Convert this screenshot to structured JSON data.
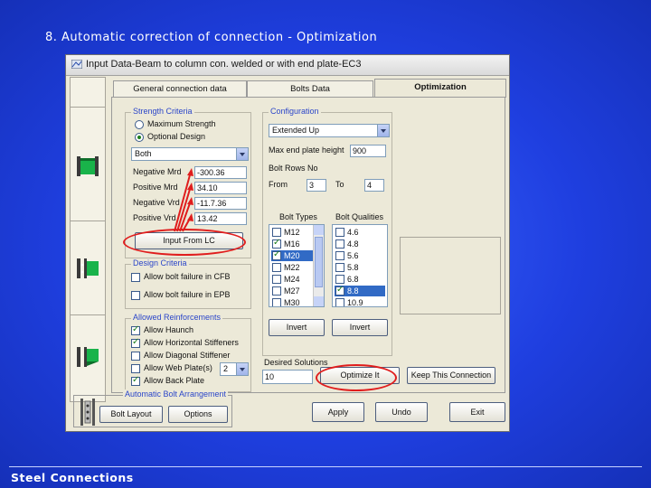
{
  "slide": {
    "title": "8. Automatic correction of connection - Optimization",
    "footer": "Steel Connections"
  },
  "window": {
    "title": "Input Data-Beam to column con. welded or with end plate-EC3",
    "tabs": [
      {
        "label": "General connection data",
        "active": false
      },
      {
        "label": "Bolts Data",
        "active": false
      },
      {
        "label": "Optimization",
        "active": true
      }
    ]
  },
  "strength": {
    "group_label": "Strength Criteria",
    "radio_max": "Maximum Strength",
    "radio_opt": "Optional Design",
    "combo_value": "Both",
    "rows": [
      {
        "label": "Negative Mrd",
        "value": "-300.36"
      },
      {
        "label": "Positive Mrd",
        "value": "34.10"
      },
      {
        "label": "Negative Vrd",
        "value": "-11.7.36"
      },
      {
        "label": "Positive Vrd",
        "value": "13.42"
      }
    ],
    "input_button": "Input From LC"
  },
  "design": {
    "group_label": "Design Criteria",
    "items": [
      {
        "label": "Allow bolt failure in CFB",
        "checked": false
      },
      {
        "label": "Allow bolt failure in EPB",
        "checked": false
      }
    ]
  },
  "reinforcements": {
    "group_label": "Allowed Reinforcements",
    "items": [
      {
        "label": "Allow Haunch",
        "checked": true
      },
      {
        "label": "Allow Horizontal Stiffeners",
        "checked": true
      },
      {
        "label": "Allow Diagonal Stiffener",
        "checked": false
      },
      {
        "label": "Allow Web Plate(s)",
        "checked": false
      },
      {
        "label": "Allow Back Plate",
        "checked": true
      }
    ],
    "web_plate_count": "2"
  },
  "configuration": {
    "group_label": "Configuration",
    "combo_value": "Extended Up",
    "max_height_label": "Max end plate height",
    "max_height_value": "900",
    "bolt_rows_label": "Bolt Rows No",
    "from_label": "From",
    "from_value": "3",
    "to_label": "To",
    "to_value": "4",
    "bolt_types_label": "Bolt Types",
    "bolt_qualities_label": "Bolt Qualities",
    "bolt_types": [
      {
        "label": "M12",
        "checked": false,
        "selected": false
      },
      {
        "label": "M16",
        "checked": true,
        "selected": false
      },
      {
        "label": "M20",
        "checked": true,
        "selected": true
      },
      {
        "label": "M22",
        "checked": false,
        "selected": false
      },
      {
        "label": "M24",
        "checked": false,
        "selected": false
      },
      {
        "label": "M27",
        "checked": false,
        "selected": false
      },
      {
        "label": "M30",
        "checked": false,
        "selected": false
      }
    ],
    "bolt_qualities": [
      {
        "label": "4.6",
        "checked": false,
        "selected": false
      },
      {
        "label": "4.8",
        "checked": false,
        "selected": false
      },
      {
        "label": "5.6",
        "checked": false,
        "selected": false
      },
      {
        "label": "5.8",
        "checked": false,
        "selected": false
      },
      {
        "label": "6.8",
        "checked": false,
        "selected": false
      },
      {
        "label": "8.8",
        "checked": true,
        "selected": true
      },
      {
        "label": "10.9",
        "checked": false,
        "selected": false
      }
    ],
    "invert_types": "Invert",
    "invert_qualities": "Invert"
  },
  "solutions": {
    "label": "Desired Solutions",
    "value": "10",
    "optimize": "Optimize It",
    "keep": "Keep This Connection"
  },
  "auto_bolt": {
    "group_label": "Automatic Bolt Arrangement",
    "bolt_layout": "Bolt Layout",
    "options": "Options"
  },
  "bottom_buttons": {
    "apply": "Apply",
    "undo": "Undo",
    "exit": "Exit"
  },
  "colors": {
    "highlight_red": "#e01d1d",
    "group_label_blue": "#2b46c9",
    "selection_blue": "#316ac5",
    "icon_green": "#19b34a"
  }
}
